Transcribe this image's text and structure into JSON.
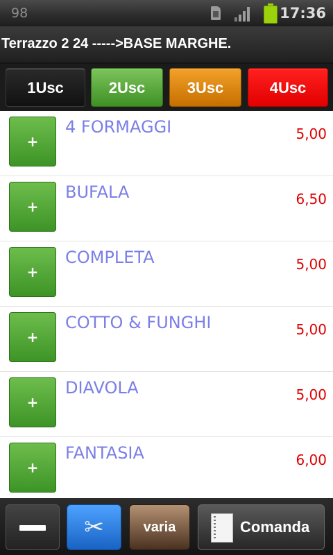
{
  "status_bar": {
    "notification": "98",
    "time": "17:36"
  },
  "header": {
    "title": "Terrazzo 2 24 ----->BASE MARGHE."
  },
  "courses": [
    {
      "label": "1Usc",
      "color": "#1a1a1a"
    },
    {
      "label": "2Usc",
      "color": "#5aab3a"
    },
    {
      "label": "3Usc",
      "color": "#e38a12"
    },
    {
      "label": "4Usc",
      "color": "#ff0000"
    }
  ],
  "add_label": "+",
  "items": [
    {
      "name": "4 FORMAGGI",
      "price": "5,00"
    },
    {
      "name": "BUFALA",
      "price": "6,50"
    },
    {
      "name": "COMPLETA",
      "price": "5,00"
    },
    {
      "name": "COTTO & FUNGHI",
      "price": "5,00"
    },
    {
      "name": "DIAVOLA",
      "price": "5,00"
    },
    {
      "name": "FANTASIA",
      "price": "6,00"
    }
  ],
  "toolbar": {
    "cut_icon": "✂",
    "varia_label": "varia",
    "comanda_label": "Comanda"
  },
  "colors": {
    "item_name": "#7b7fe6",
    "price": "#e00000",
    "add_button": "#4fa834"
  }
}
